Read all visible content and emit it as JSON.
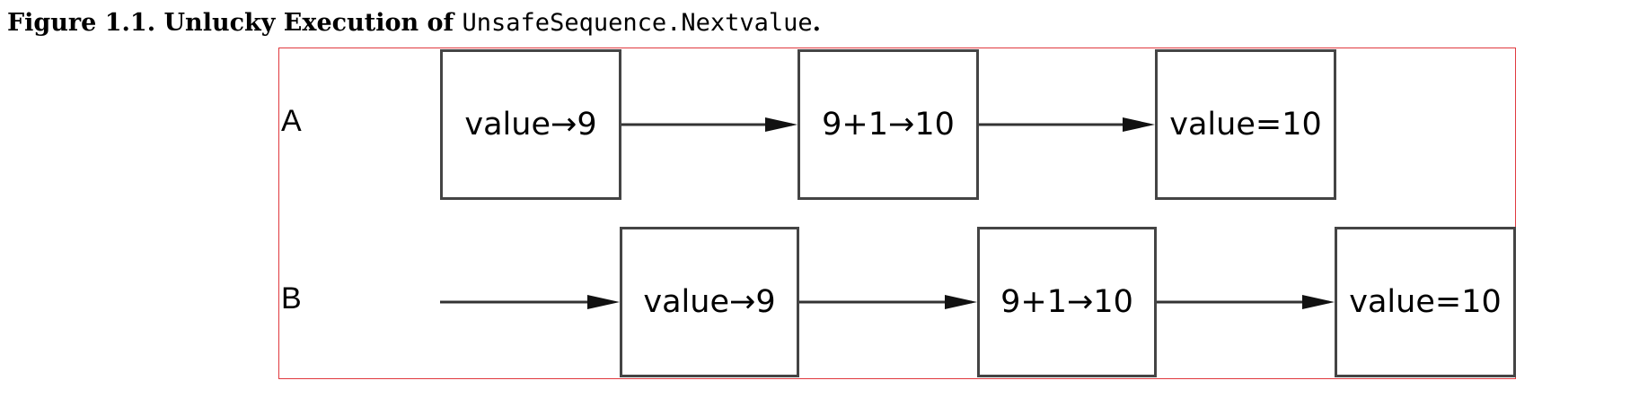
{
  "caption": {
    "prefix": "Figure 1.1. Unlucky Execution of ",
    "code": "UnsafeSequence.Nextvalue",
    "suffix": "."
  },
  "lanes": {
    "a": {
      "label": "A",
      "steps": [
        "value→9",
        "9+1→10",
        "value=10"
      ]
    },
    "b": {
      "label": "B",
      "steps": [
        "value→9",
        "9+1→10",
        "value=10"
      ]
    }
  },
  "colors": {
    "frame": "#e0393e",
    "box_border": "#444444",
    "arrow": "#222222"
  }
}
